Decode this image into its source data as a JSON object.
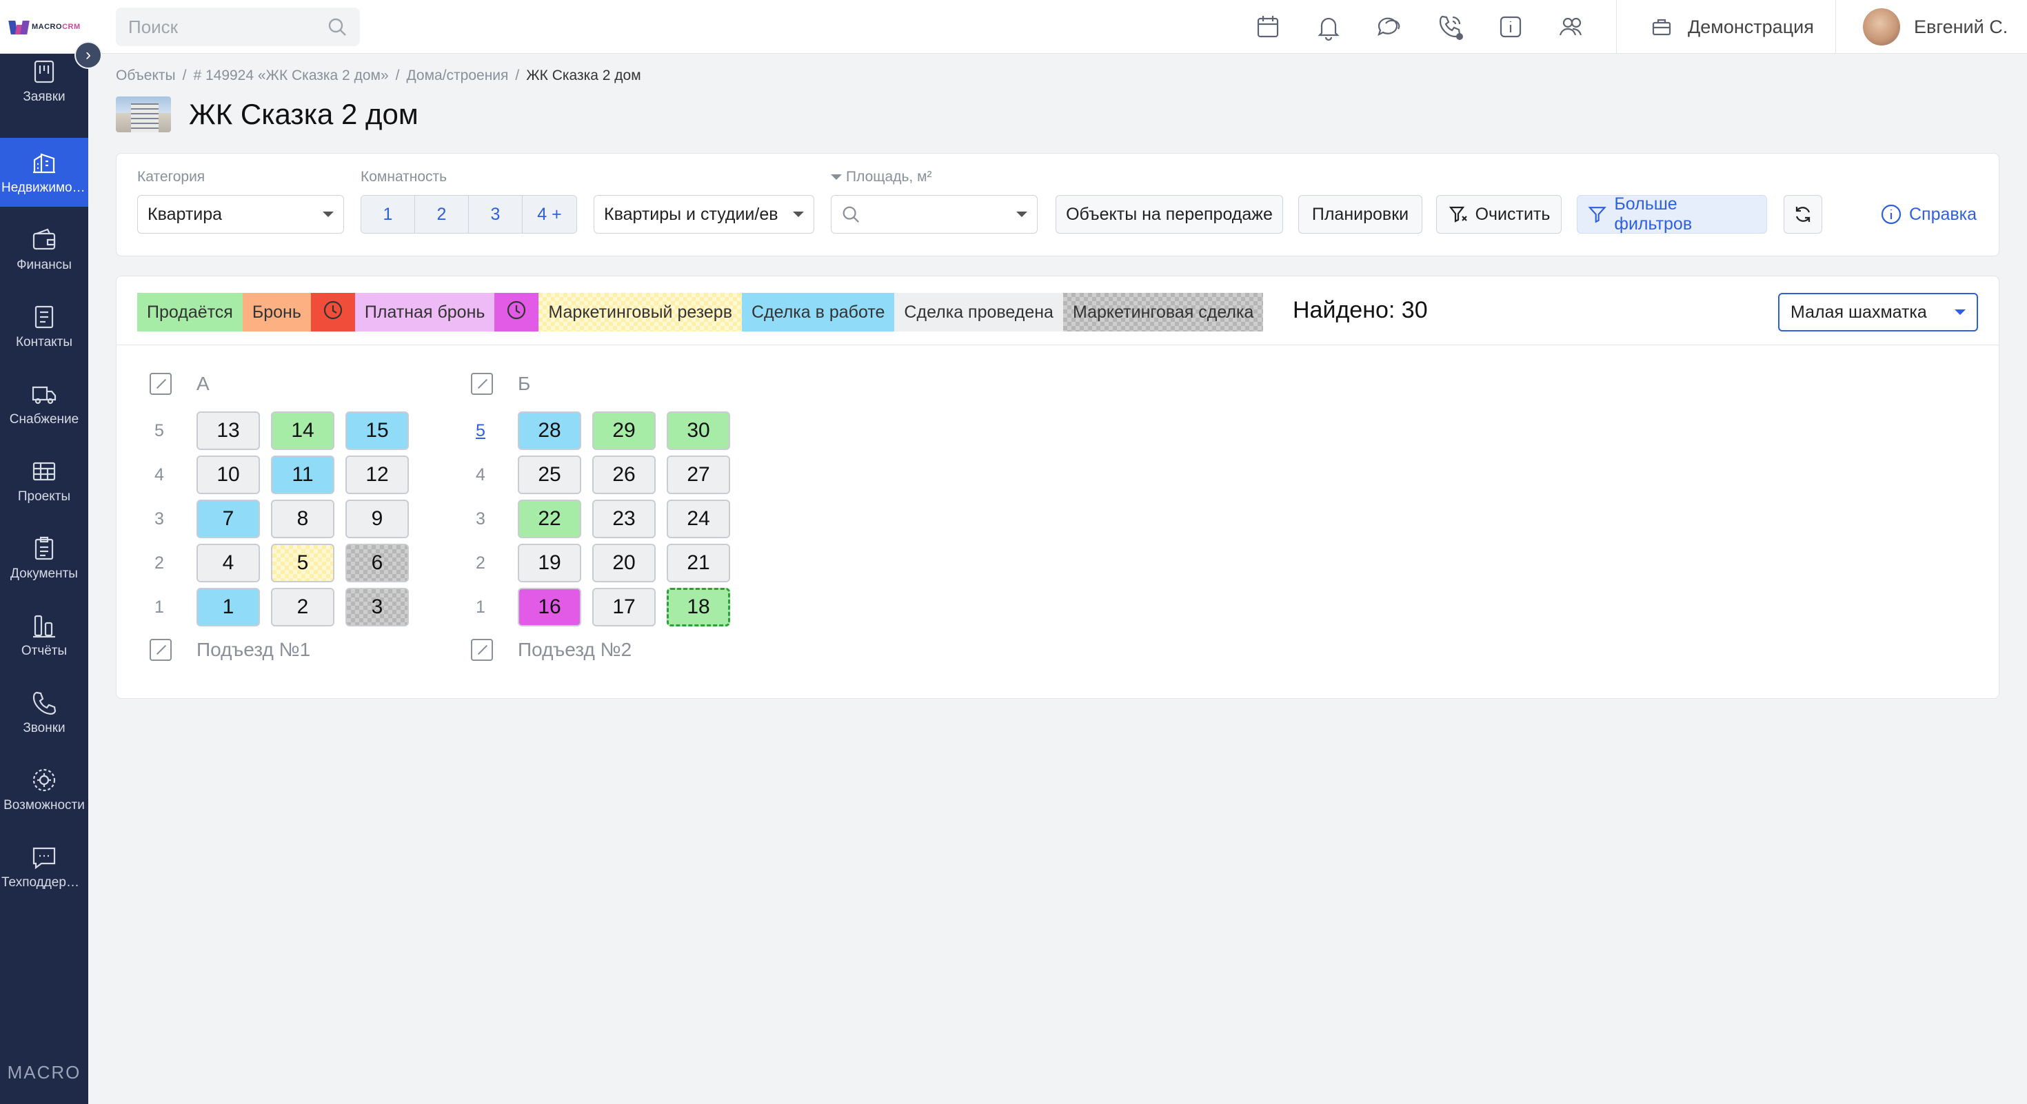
{
  "app": {
    "logo_text": "MACRO",
    "logo_accent": "CRM",
    "sidebar_footer": "MACRO"
  },
  "colors": {
    "sidebar_bg": "#1e2a47",
    "accent": "#2e5fe0",
    "for_sale": "#a6eba6",
    "reserve": "#fdb183",
    "reserve_timer": "#f04e3a",
    "paid_reserve": "#eebbf6",
    "paid_reserve_timer": "#e15be7",
    "marketing_reserve": "#fff0a8",
    "deal_in_progress": "#8fdbf8",
    "deal_done": "#eeeff1",
    "marketing_deal": "#b6b6b6"
  },
  "sidebar": {
    "items": [
      {
        "label": "Заявки",
        "icon": "requests-icon"
      },
      {
        "label": "Недвижимость",
        "icon": "buildings-icon",
        "active": true
      },
      {
        "label": "Финансы",
        "icon": "wallet-icon"
      },
      {
        "label": "Контакты",
        "icon": "contacts-icon"
      },
      {
        "label": "Снабжение",
        "icon": "truck-icon"
      },
      {
        "label": "Проекты",
        "icon": "projects-icon"
      },
      {
        "label": "Документы",
        "icon": "documents-icon"
      },
      {
        "label": "Отчёты",
        "icon": "reports-icon"
      },
      {
        "label": "Звонки",
        "icon": "phone-icon"
      },
      {
        "label": "Возможности",
        "icon": "settings-icon"
      },
      {
        "label": "Техподдержка",
        "icon": "support-icon"
      }
    ]
  },
  "topbar": {
    "search_placeholder": "Поиск",
    "icons": [
      "calendar-icon",
      "bell-icon",
      "chat-icon",
      "phone-call-icon",
      "info-icon",
      "users-icon"
    ],
    "demo_label": "Демонстрация",
    "user_name": "Евгений С."
  },
  "breadcrumb": [
    "Объекты",
    "# 149924 «ЖК Сказка 2 дом»",
    "Дома/строения",
    "ЖК Сказка 2 дом"
  ],
  "page_title": "ЖК Сказка 2 дом",
  "filters": {
    "category_label": "Категория",
    "category_value": "Квартира",
    "rooms_label": "Комнатность",
    "rooms": [
      "1",
      "2",
      "3",
      "4 +"
    ],
    "type_value": "Квартиры и студии/ев",
    "area_label": "Площадь, м²",
    "resale_button": "Объекты на перепродаже",
    "layouts_button": "Планировки",
    "clear_button": "Очистить",
    "more_filters_button": "Больше фильтров",
    "help_link": "Справка"
  },
  "legend": [
    {
      "key": "for_sale",
      "label": "Продаётся"
    },
    {
      "key": "reserve",
      "label": "Бронь"
    },
    {
      "key": "reserve_timer",
      "label": ""
    },
    {
      "key": "paid_reserve",
      "label": "Платная бронь"
    },
    {
      "key": "paid_reserve_timer",
      "label": ""
    },
    {
      "key": "marketing_reserve",
      "label": "Маркетинговый резерв"
    },
    {
      "key": "deal_in_progress",
      "label": "Сделка в работе"
    },
    {
      "key": "deal_done",
      "label": "Сделка проведена"
    },
    {
      "key": "marketing_deal",
      "label": "Маркетинговая сделка"
    }
  ],
  "found_text": "Найдено: 30",
  "view_select": "Малая шахматка",
  "sections": [
    {
      "name": "А",
      "entrance": "Подъезд №1",
      "floors": [
        {
          "floor": "5",
          "units": [
            {
              "n": "13",
              "s": "deal_done"
            },
            {
              "n": "14",
              "s": "for_sale"
            },
            {
              "n": "15",
              "s": "deal_in_progress"
            }
          ]
        },
        {
          "floor": "4",
          "units": [
            {
              "n": "10",
              "s": "deal_done"
            },
            {
              "n": "11",
              "s": "deal_in_progress"
            },
            {
              "n": "12",
              "s": "deal_done"
            }
          ]
        },
        {
          "floor": "3",
          "units": [
            {
              "n": "7",
              "s": "deal_in_progress"
            },
            {
              "n": "8",
              "s": "deal_done"
            },
            {
              "n": "9",
              "s": "deal_done"
            }
          ]
        },
        {
          "floor": "2",
          "units": [
            {
              "n": "4",
              "s": "deal_done"
            },
            {
              "n": "5",
              "s": "marketing_reserve"
            },
            {
              "n": "6",
              "s": "marketing_deal"
            }
          ]
        },
        {
          "floor": "1",
          "units": [
            {
              "n": "1",
              "s": "deal_in_progress"
            },
            {
              "n": "2",
              "s": "deal_done"
            },
            {
              "n": "3",
              "s": "marketing_deal"
            }
          ]
        }
      ]
    },
    {
      "name": "Б",
      "entrance": "Подъезд №2",
      "floors": [
        {
          "floor": "5",
          "link": true,
          "units": [
            {
              "n": "28",
              "s": "deal_in_progress"
            },
            {
              "n": "29",
              "s": "for_sale"
            },
            {
              "n": "30",
              "s": "for_sale"
            }
          ]
        },
        {
          "floor": "4",
          "units": [
            {
              "n": "25",
              "s": "deal_done"
            },
            {
              "n": "26",
              "s": "deal_done"
            },
            {
              "n": "27",
              "s": "deal_done"
            }
          ]
        },
        {
          "floor": "3",
          "units": [
            {
              "n": "22",
              "s": "for_sale"
            },
            {
              "n": "23",
              "s": "deal_done"
            },
            {
              "n": "24",
              "s": "deal_done"
            }
          ]
        },
        {
          "floor": "2",
          "units": [
            {
              "n": "19",
              "s": "deal_done"
            },
            {
              "n": "20",
              "s": "deal_done"
            },
            {
              "n": "21",
              "s": "deal_done"
            }
          ]
        },
        {
          "floor": "1",
          "units": [
            {
              "n": "16",
              "s": "paid_reserve_timer"
            },
            {
              "n": "17",
              "s": "deal_done"
            },
            {
              "n": "18",
              "s": "for_sale",
              "highlight": true
            }
          ]
        }
      ]
    }
  ]
}
